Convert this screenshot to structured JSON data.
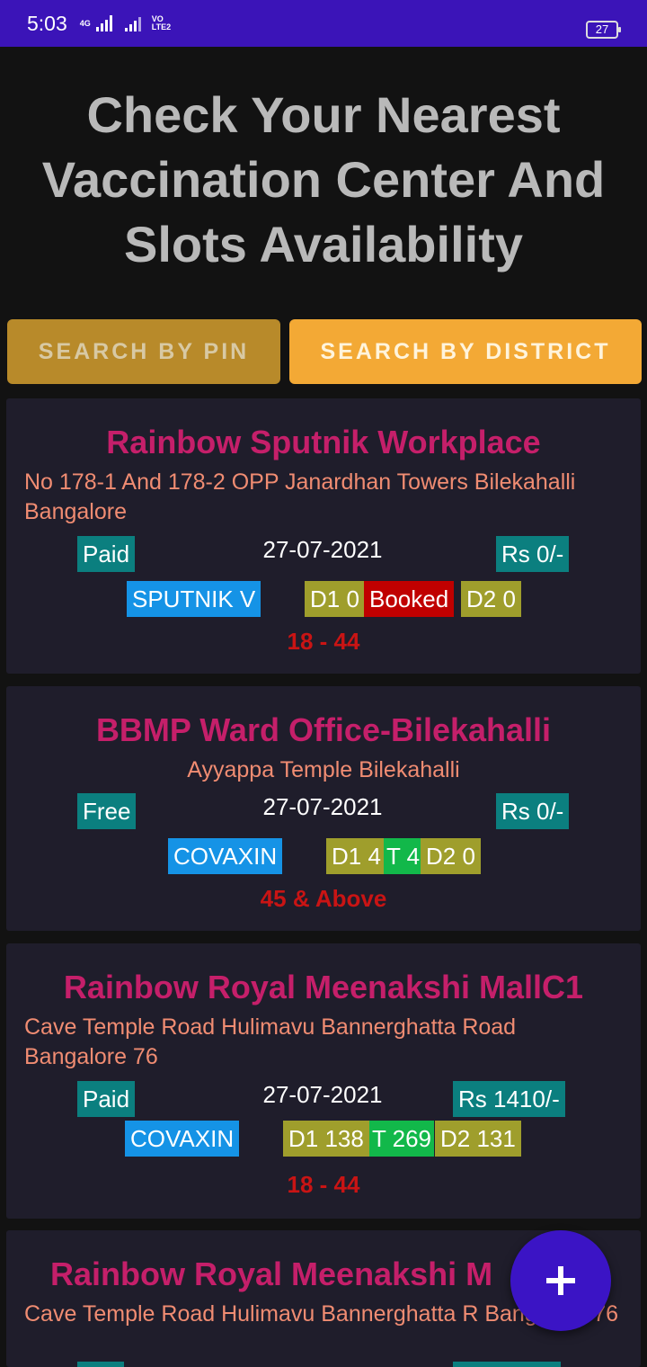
{
  "status_bar": {
    "time": "5:03",
    "net1_label": "4G",
    "volte_label_1": "VO",
    "volte_label_2": "LTE2",
    "battery": "27"
  },
  "header": {
    "title": "Check Your Nearest Vaccination Center And Slots Availability"
  },
  "tabs": {
    "pin": "SEARCH BY PIN",
    "district": "SEARCH BY DISTRICT"
  },
  "centers": [
    {
      "name": "Rainbow Sputnik Workplace",
      "address": "No 178-1 And 178-2 OPP Janardhan Towers Bilekahalli Bangalore",
      "fee_type": "Paid",
      "date": "27-07-2021",
      "fee": "Rs 0/-",
      "vaccine": "SPUTNIK V",
      "dose1": "D1 0",
      "status": "Booked",
      "dose2": "D2 0",
      "age": "18 - 44"
    },
    {
      "name": "BBMP Ward Office-Bilekahalli",
      "address": "Ayyappa Temple Bilekahalli",
      "fee_type": "Free",
      "date": "27-07-2021",
      "fee": "Rs 0/-",
      "vaccine": "COVAXIN",
      "dose1": "D1 4",
      "total": "T 4",
      "dose2": "D2 0",
      "age": "45 & Above"
    },
    {
      "name": "Rainbow Royal Meenakshi MallC1",
      "address": "Cave Temple Road  Hulimavu Bannerghatta Road Bangalore 76",
      "fee_type": "Paid",
      "date": "27-07-2021",
      "fee": "Rs 1410/-",
      "vaccine": "COVAXIN",
      "dose1": "D1 138",
      "total": "T 269",
      "dose2": "D2 131",
      "age": "18 - 44"
    },
    {
      "name": "Rainbow Royal Meenakshi M",
      "address": "Cave Temple Road  Hulimavu Bannerghatta R Bangalore 76"
    }
  ],
  "colors": {
    "status_bar": "#3b14b8",
    "background": "#121212",
    "card": "#1f1d2b",
    "center_name": "#c51f6a",
    "address": "#f08c72",
    "teal_badge": "#0b7f7f",
    "vaccine_badge": "#1593e6",
    "dose_badge": "#9f9e2c",
    "booked_badge": "#c00000",
    "total_badge": "#12b84a",
    "age_text": "#c91414",
    "fab": "#3b14c5"
  },
  "fab": {
    "icon": "plus-icon"
  }
}
